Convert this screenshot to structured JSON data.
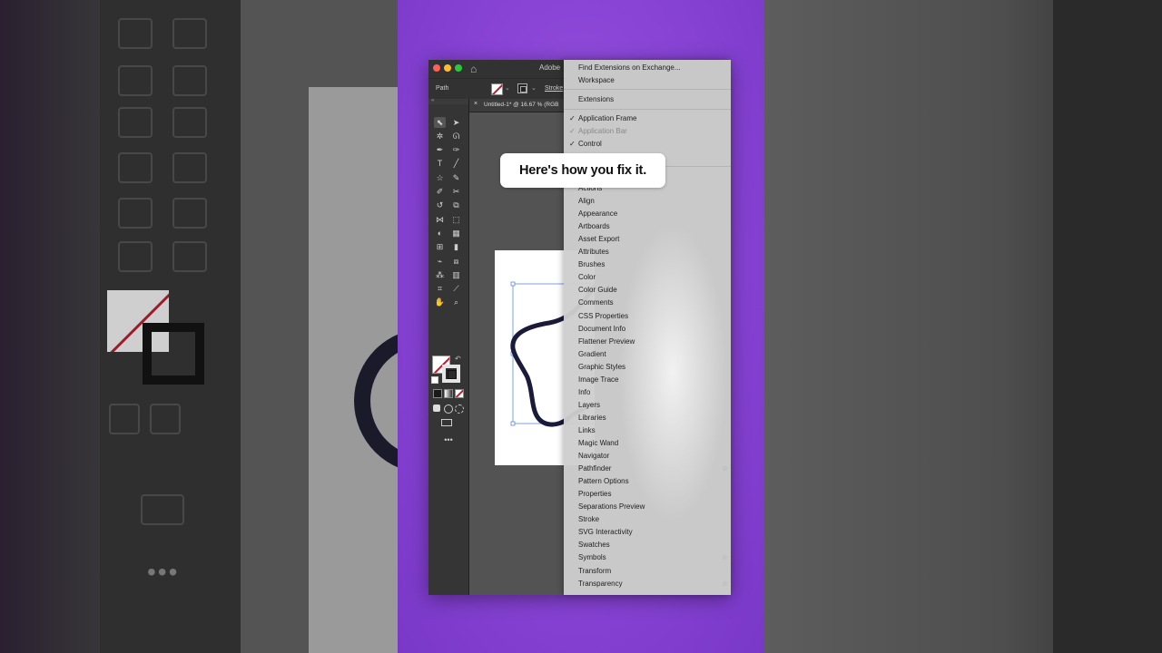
{
  "window": {
    "app_name": "Adobe",
    "traffic_lights": [
      "#ff5f57",
      "#febc2e",
      "#28c840"
    ],
    "home_icon": "home-icon"
  },
  "control_bar": {
    "selection_label": "Path",
    "stroke_label": "Stroke"
  },
  "document": {
    "tab_title": "Untitled-1* @ 16.67 % (RGB",
    "tab_close": "×"
  },
  "toolbar": {
    "tools": [
      {
        "icon": "selection-tool-icon",
        "glyph": "⬉"
      },
      {
        "icon": "direct-selection-tool-icon",
        "glyph": "➤"
      },
      {
        "icon": "magic-wand-tool-icon",
        "glyph": "✲"
      },
      {
        "icon": "lasso-tool-icon",
        "glyph": "ᘏ"
      },
      {
        "icon": "pen-tool-icon",
        "glyph": "✒"
      },
      {
        "icon": "curvature-tool-icon",
        "glyph": "✑"
      },
      {
        "icon": "type-tool-icon",
        "glyph": "T"
      },
      {
        "icon": "line-tool-icon",
        "glyph": "╱"
      },
      {
        "icon": "star-tool-icon",
        "glyph": "☆"
      },
      {
        "icon": "paintbrush-tool-icon",
        "glyph": "✎"
      },
      {
        "icon": "shaper-tool-icon",
        "glyph": "✐"
      },
      {
        "icon": "scissors-tool-icon",
        "glyph": "✂"
      },
      {
        "icon": "rotate-tool-icon",
        "glyph": "↺"
      },
      {
        "icon": "scale-tool-icon",
        "glyph": "⧉"
      },
      {
        "icon": "width-tool-icon",
        "glyph": "⋈"
      },
      {
        "icon": "free-transform-tool-icon",
        "glyph": "⬚"
      },
      {
        "icon": "shape-builder-tool-icon",
        "glyph": "◐"
      },
      {
        "icon": "perspective-grid-tool-icon",
        "glyph": "▦"
      },
      {
        "icon": "mesh-tool-icon",
        "glyph": "⊞"
      },
      {
        "icon": "gradient-tool-icon",
        "glyph": "▮"
      },
      {
        "icon": "eyedropper-tool-icon",
        "glyph": "⌁"
      },
      {
        "icon": "blend-tool-icon",
        "glyph": "⧈"
      },
      {
        "icon": "symbol-sprayer-tool-icon",
        "glyph": "⁂"
      },
      {
        "icon": "column-graph-tool-icon",
        "glyph": "▥"
      },
      {
        "icon": "artboard-tool-icon",
        "glyph": "⌗"
      },
      {
        "icon": "slice-tool-icon",
        "glyph": "⟋"
      },
      {
        "icon": "hand-tool-icon",
        "glyph": "✋"
      },
      {
        "icon": "zoom-tool-icon",
        "glyph": "⌕"
      }
    ],
    "more_tools": "•••"
  },
  "caption": {
    "text": "Here's how you fix it."
  },
  "menu": {
    "top_items": [
      "Find Extensions on Exchange...",
      "Workspace"
    ],
    "extensions": "Extensions",
    "checked_items": [
      {
        "label": "Application Frame",
        "checked": true,
        "disabled": false
      },
      {
        "label": "Application Bar",
        "checked": true,
        "disabled": true
      },
      {
        "label": "Control",
        "checked": true,
        "disabled": false
      }
    ],
    "panels": [
      "Actions",
      "Align",
      "Appearance",
      "Artboards",
      "Asset Export",
      "Attributes",
      "Brushes",
      "Color",
      "Color Guide",
      "Comments",
      "CSS Properties",
      "Document Info",
      "Flattener Preview",
      "Gradient",
      "Graphic Styles",
      "Image Trace",
      "Info",
      "Layers",
      "Libraries",
      "Links",
      "Magic Wand",
      "Navigator",
      "Pathfinder",
      "Pattern Options",
      "Properties",
      "Separations Preview",
      "Stroke",
      "SVG Interactivity",
      "Swatches",
      "Symbols",
      "Transform",
      "Transparency"
    ],
    "starred_panels": [
      "Pathfinder",
      "Symbols",
      "Transparency"
    ]
  },
  "colors": {
    "background_purple": "#8a45d6",
    "fill_slash": "#c01a2a",
    "star_stroke": "#1a1a3a"
  }
}
